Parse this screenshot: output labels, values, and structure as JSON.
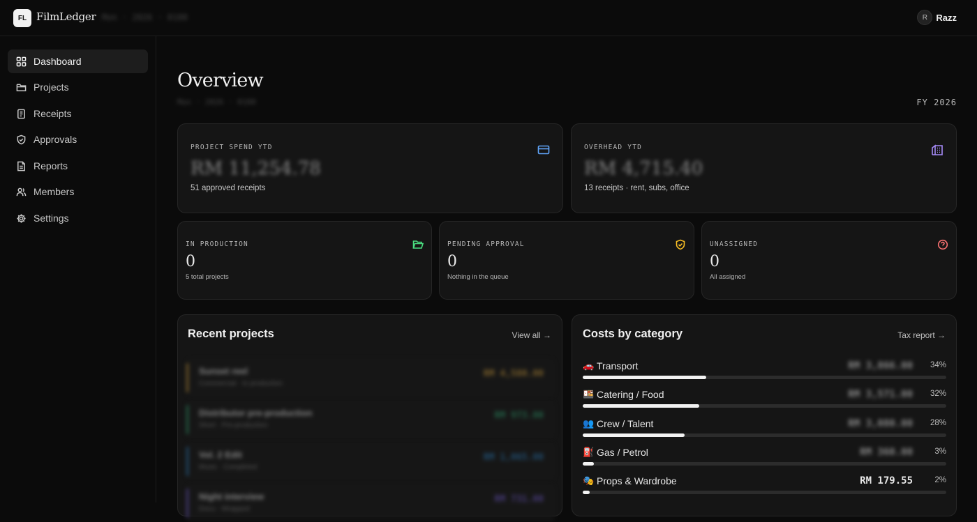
{
  "app": {
    "logo_text": "FL",
    "name": "FilmLedger",
    "top_context": "Mon · 2026 · 0100"
  },
  "user": {
    "initial": "R",
    "name": "Razz"
  },
  "sidebar": {
    "items": [
      {
        "label": "Dashboard",
        "icon": "grid-icon",
        "active": true
      },
      {
        "label": "Projects",
        "icon": "folder-icon"
      },
      {
        "label": "Receipts",
        "icon": "receipt-icon"
      },
      {
        "label": "Approvals",
        "icon": "shield-icon"
      },
      {
        "label": "Reports",
        "icon": "document-icon"
      },
      {
        "label": "Members",
        "icon": "users-icon"
      },
      {
        "label": "Settings",
        "icon": "gear-icon"
      }
    ]
  },
  "header": {
    "title": "Overview",
    "subtitle": "Mon · 2026 · 0100",
    "fiscal_year": "FY 2026"
  },
  "kpis": {
    "project_spend": {
      "label": "PROJECT SPEND YTD",
      "value": "RM 11,254.78",
      "sub": "51 approved receipts",
      "icon": "credit-card-icon"
    },
    "overhead": {
      "label": "OVERHEAD YTD",
      "value": "RM 4,715.40",
      "sub": "13 receipts · rent, subs, office",
      "icon": "building-icon"
    }
  },
  "stats": [
    {
      "label": "IN PRODUCTION",
      "value": "0",
      "sub": "5 total projects",
      "icon": "folder-open-icon",
      "color": "#4ade80"
    },
    {
      "label": "PENDING APPROVAL",
      "value": "0",
      "sub": "Nothing in the queue",
      "icon": "shield-check-icon",
      "color": "#fbbf24"
    },
    {
      "label": "UNASSIGNED",
      "value": "0",
      "sub": "All assigned",
      "icon": "help-circle-icon",
      "color": "#f87171"
    }
  ],
  "recent_projects": {
    "title": "Recent projects",
    "link": "View all →",
    "items": [
      {
        "name": "Sunset reel",
        "meta": "Commercial · In production",
        "amount": "RM 4,580.00",
        "color": "#c99a3b"
      },
      {
        "name": "Distributor pre-production",
        "meta": "Short · Pre-production",
        "amount": "RM 973.00",
        "color": "#2f9e6e"
      },
      {
        "name": "Vol. 2 Edit",
        "meta": "Music · Completed",
        "amount": "RM 1,065.00",
        "color": "#2b7bb9"
      },
      {
        "name": "Night interview",
        "meta": "Docu · Wrapped",
        "amount": "RM 731.00",
        "color": "#6e59c9"
      }
    ]
  },
  "costs": {
    "title": "Costs by category",
    "link": "Tax report →",
    "items": [
      {
        "emoji": "🚗",
        "name": "Transport",
        "amount": "RM 3,866.00",
        "percent_label": "34%",
        "percent": 34
      },
      {
        "emoji": "🍱",
        "name": "Catering / Food",
        "amount": "RM 3,571.00",
        "percent_label": "32%",
        "percent": 32
      },
      {
        "emoji": "👥",
        "name": "Crew / Talent",
        "amount": "RM 3,080.00",
        "percent_label": "28%",
        "percent": 28
      },
      {
        "emoji": "⛽",
        "name": "Gas / Petrol",
        "amount": "RM 360.00",
        "percent_label": "3%",
        "percent": 3
      },
      {
        "emoji": "🎭",
        "name": "Props & Wardrobe",
        "amount": "RM 179.55",
        "percent_label": "2%",
        "percent": 2
      }
    ]
  }
}
